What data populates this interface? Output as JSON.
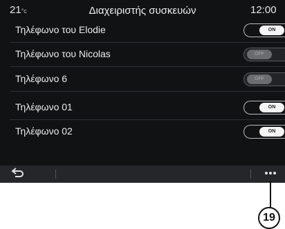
{
  "status_bar": {
    "temperature": "21",
    "temperature_unit": "°c",
    "title": "Διαχειριστής συσκευών",
    "time": "12:00"
  },
  "devices": [
    {
      "name": "Τηλέφωνο του Elodie",
      "state": "ON"
    },
    {
      "name": "Τηλέφωνο του Nicolas",
      "state": "OFF"
    },
    {
      "name": "Τηλέφωνο 6",
      "state": "OFF"
    },
    {
      "name": "Τηλέφωνο 01",
      "state": "ON"
    },
    {
      "name": "Τηλέφωνο 02",
      "state": "ON"
    }
  ],
  "bottom_bar": {
    "back_icon": "back-arrow-icon",
    "more_icon": "more-dots-icon",
    "more_label": "..."
  },
  "callout": {
    "number": "19"
  },
  "colors": {
    "screen_bg": "#111214",
    "bottom_bar_bg": "#25262a",
    "toggle_on": "#f4f4f4",
    "toggle_off": "#6b6c70"
  }
}
